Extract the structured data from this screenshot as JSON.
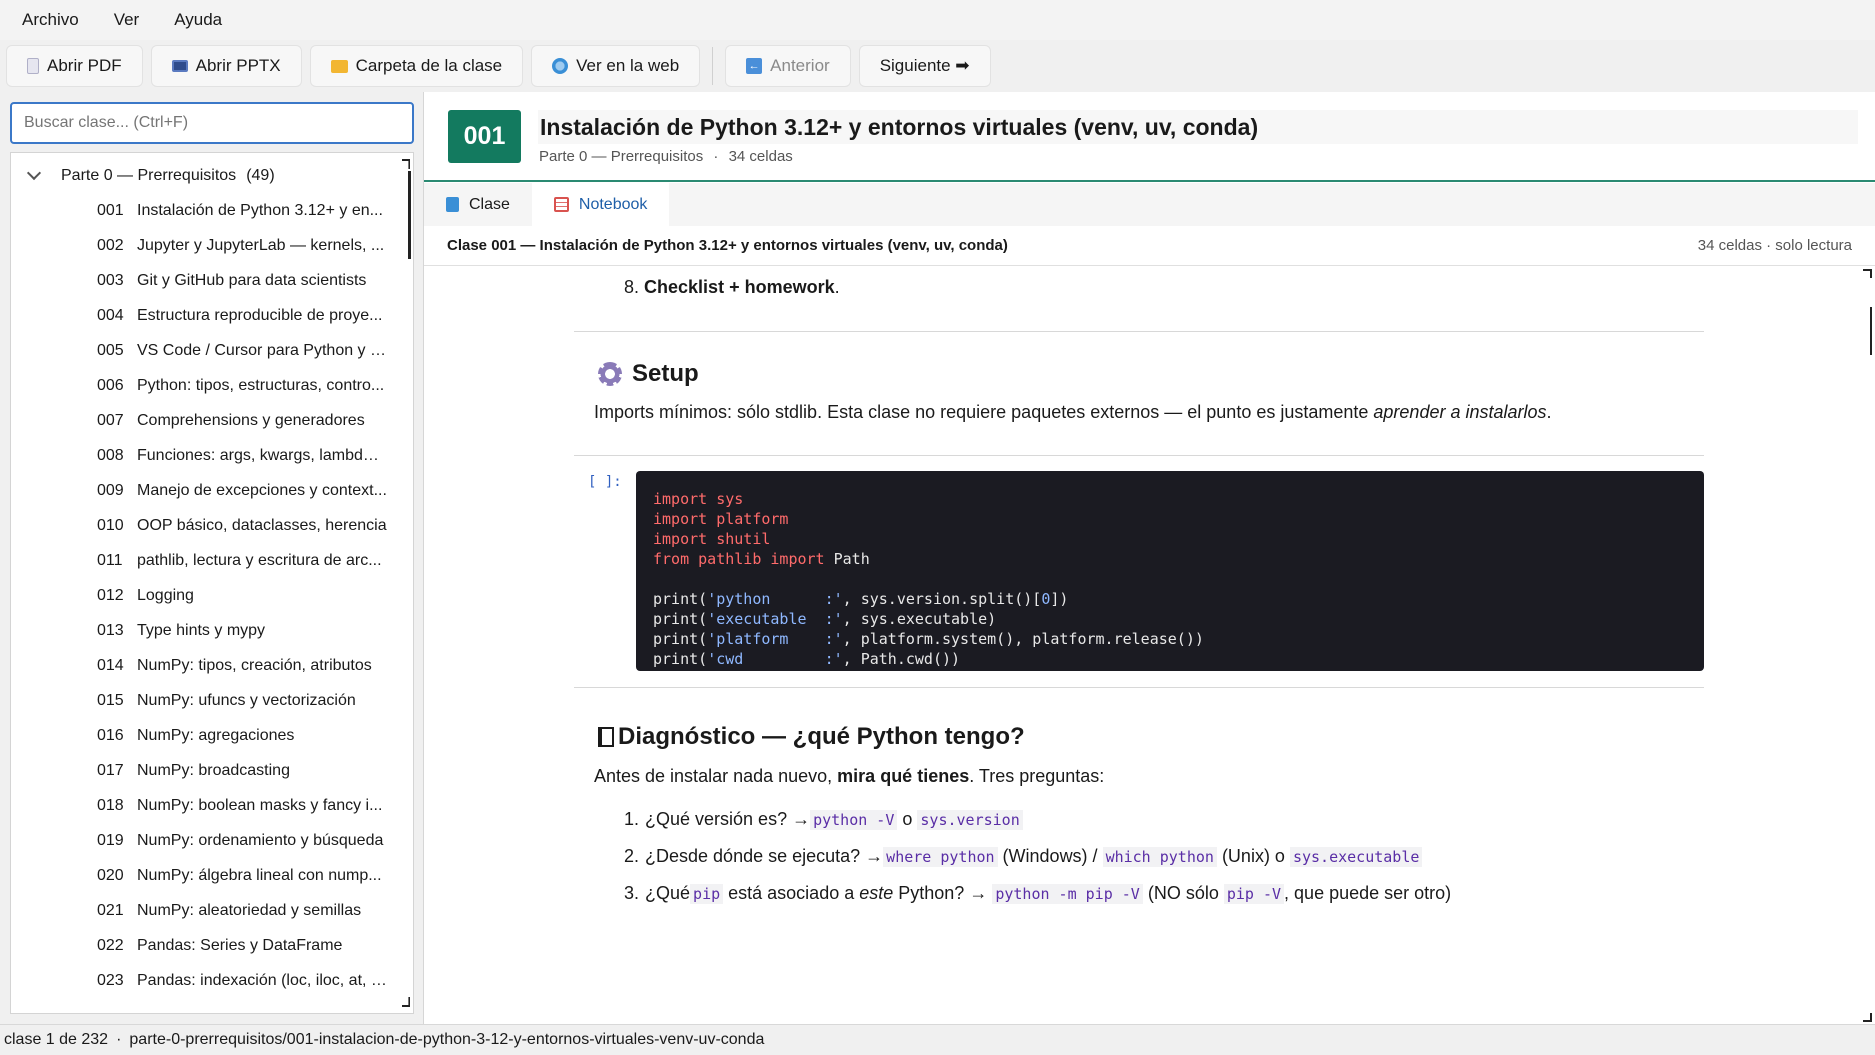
{
  "menu": [
    "Archivo",
    "Ver",
    "Ayuda"
  ],
  "toolbar": {
    "open_pdf": "Abrir PDF",
    "open_pptx": "Abrir PPTX",
    "folder": "Carpeta de la clase",
    "web": "Ver en la web",
    "prev": "Anterior",
    "next": "Siguiente ➡"
  },
  "search": {
    "placeholder": "Buscar clase... (Ctrl+F)"
  },
  "tree": {
    "group_label": "Parte 0 — Prerrequisitos",
    "group_count": "(49)",
    "items": [
      {
        "num": "001",
        "title": "Instalación de Python 3.12+ y en..."
      },
      {
        "num": "002",
        "title": "Jupyter y JupyterLab — kernels, ..."
      },
      {
        "num": "003",
        "title": "Git y GitHub para data scientists"
      },
      {
        "num": "004",
        "title": "Estructura reproducible de proye..."
      },
      {
        "num": "005",
        "title": "VS Code / Cursor para Python y J..."
      },
      {
        "num": "006",
        "title": "Python: tipos, estructuras, contro..."
      },
      {
        "num": "007",
        "title": "Comprehensions y generadores"
      },
      {
        "num": "008",
        "title": "Funciones: args, kwargs, lambdas..."
      },
      {
        "num": "009",
        "title": "Manejo de excepciones y context..."
      },
      {
        "num": "010",
        "title": "OOP básico, dataclasses, herencia"
      },
      {
        "num": "011",
        "title": "pathlib, lectura y escritura de arc..."
      },
      {
        "num": "012",
        "title": "Logging"
      },
      {
        "num": "013",
        "title": "Type hints y mypy"
      },
      {
        "num": "014",
        "title": "NumPy: tipos, creación, atributos"
      },
      {
        "num": "015",
        "title": "NumPy: ufuncs y vectorización"
      },
      {
        "num": "016",
        "title": "NumPy: agregaciones"
      },
      {
        "num": "017",
        "title": "NumPy: broadcasting"
      },
      {
        "num": "018",
        "title": "NumPy: boolean masks y fancy i..."
      },
      {
        "num": "019",
        "title": "NumPy: ordenamiento y búsqueda"
      },
      {
        "num": "020",
        "title": "NumPy: álgebra lineal con nump..."
      },
      {
        "num": "021",
        "title": "NumPy: aleatoriedad y semillas"
      },
      {
        "num": "022",
        "title": "Pandas: Series y DataFrame"
      },
      {
        "num": "023",
        "title": "Pandas: indexación (loc, iloc, at, i..."
      }
    ]
  },
  "header": {
    "badge": "001",
    "title": "Instalación de Python 3.12+ y entornos virtuales (venv, uv, conda)",
    "part": "Parte 0 — Prerrequisitos",
    "sep": "·",
    "cells": "34 celdas"
  },
  "tabs": {
    "clase": "Clase",
    "notebook": "Notebook"
  },
  "nb_head": {
    "title": "Clase 001 — Instalación de Python 3.12+ y entornos virtuales (venv, uv, conda)",
    "meta": "34 celdas · solo lectura"
  },
  "notebook": {
    "li8_num": "8.",
    "li8_text": "Checklist + homework",
    "li8_end": ".",
    "setup_heading": "Setup",
    "setup_p_pre": "Imports mínimos: sólo stdlib. Esta clase no requiere paquetes externos — el punto es justamente ",
    "setup_p_em": "aprender a instalarlos",
    "setup_p_end": ".",
    "prompt": "[ ]:",
    "diag_heading": "Diagnóstico — ¿qué Python tengo?",
    "diag_p_pre": "Antes de instalar nada nuevo, ",
    "diag_p_bold": "mira qué tienes",
    "diag_p_end": ". Tres preguntas:",
    "q1": {
      "num": "1.",
      "pre": "¿Qué versión es? → ",
      "c1": "python -V",
      "mid": " o ",
      "c2": "sys.version"
    },
    "q2": {
      "num": "2.",
      "pre": "¿Desde dónde se ejecuta? → ",
      "c1": "where python",
      "mid1": " (Windows) / ",
      "c2": "which python",
      "mid2": " (Unix) o ",
      "c3": "sys.executable"
    },
    "q3": {
      "num": "3.",
      "pre": "¿Qué ",
      "c1": "pip",
      "mid1": " está asociado a ",
      "em": "este",
      "mid2": " Python? → ",
      "c2": "python -m pip -V",
      "mid3": " (NO sólo ",
      "c3": "pip -V",
      "end": ", que puede ser otro)"
    }
  },
  "status": {
    "count": "clase 1 de 232",
    "sep": "·",
    "path": "parte-0-prerrequisitos/001-instalacion-de-python-3-12-y-entornos-virtuales-venv-uv-conda"
  },
  "colors": {
    "accent": "#137a5f",
    "tab_active": "#1f5fa8",
    "code_bg": "#1b1b22",
    "keyword": "#ff6b6b",
    "string": "#8fb8ff"
  },
  "icons": [
    "pdf-icon",
    "pptx-icon",
    "folder-icon",
    "globe-icon",
    "back-arrow-icon",
    "book-icon",
    "notebook-icon",
    "gear-icon"
  ]
}
